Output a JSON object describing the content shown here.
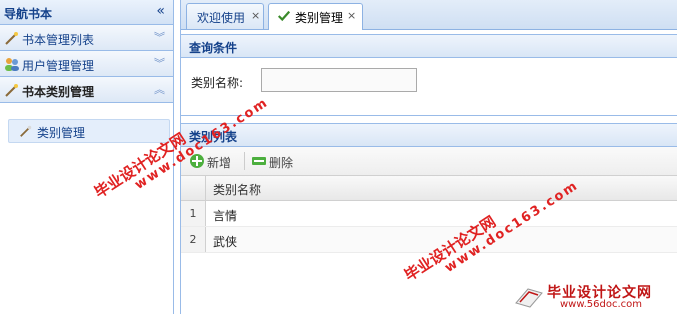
{
  "nav": {
    "title": "导航书本",
    "sections": [
      {
        "label": "书本管理列表",
        "icon": "wand-icon"
      },
      {
        "label": "用户管理管理",
        "icon": "users-icon"
      },
      {
        "label": "书本类别管理",
        "icon": "wand-icon"
      }
    ],
    "active_item": {
      "label": "类别管理",
      "icon": "wand-icon"
    }
  },
  "tabs": [
    {
      "label": "欢迎使用",
      "close": "×",
      "active": false
    },
    {
      "label": "类别管理",
      "close": "×",
      "active": true
    }
  ],
  "query": {
    "title": "查询条件",
    "field_label": "类别名称:",
    "field_value": ""
  },
  "list": {
    "title": "类别列表",
    "add_label": "新增",
    "delete_label": "删除",
    "column": "类别名称",
    "rows": [
      {
        "num": "1",
        "name": "言情"
      },
      {
        "num": "2",
        "name": "武侠"
      }
    ]
  },
  "watermark": {
    "text_cn": "毕业设计论文网",
    "text_url": "www.doc163.com",
    "logo_cn": "毕业设计论文网",
    "logo_url": "www.56doc.com"
  },
  "colors": {
    "header_text": "#15428b",
    "border": "#99bbe8",
    "watermark": "#e02222"
  }
}
